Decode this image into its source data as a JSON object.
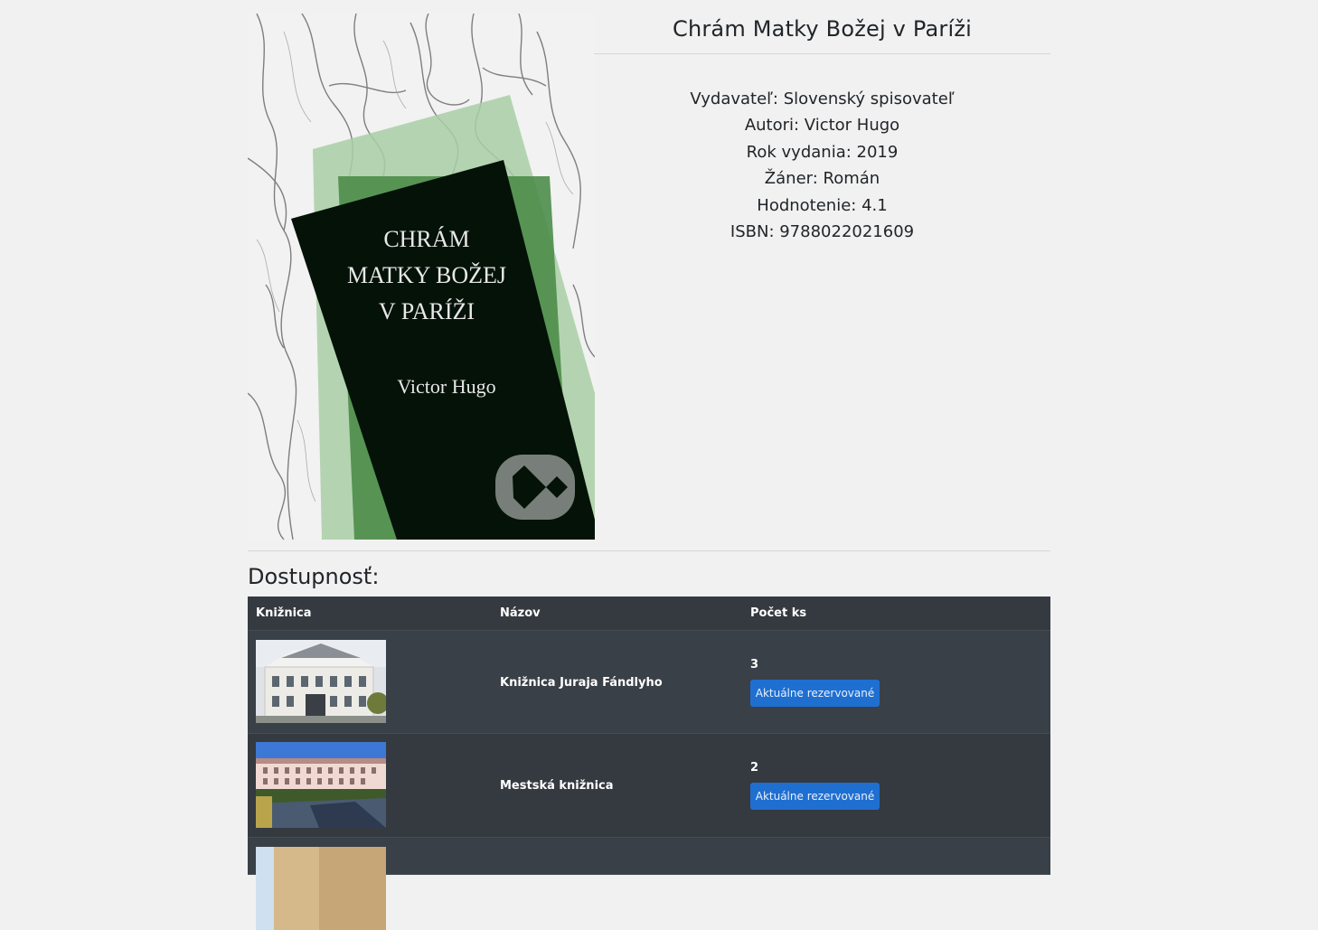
{
  "book": {
    "title": "Chrám Matky Božej v Paríži",
    "cover": {
      "line1": "CHRÁM",
      "line2": "MATKY BOŽEJ",
      "line3": "V PARÍŽI",
      "author": "Victor Hugo"
    },
    "details": [
      "Vydavateľ: Slovenský spisovateľ",
      "Autori: Victor Hugo",
      "Rok vydania: 2019",
      "Žáner: Román",
      "Hodnotenie: 4.1",
      "ISBN: 9788022021609"
    ]
  },
  "availability": {
    "heading": "Dostupnosť:",
    "columns": [
      "Knižnica",
      "Názov",
      "Počet ks"
    ],
    "rows": [
      {
        "name": "Knižnica Juraja Fándlyho",
        "count": "3",
        "button": "Aktuálne rezervované"
      },
      {
        "name": "Mestská knižnica",
        "count": "2",
        "button": "Aktuálne rezervované"
      }
    ]
  },
  "colors": {
    "page_bg": "#f1f1f1",
    "table_bg": "#343a40",
    "button_bg": "#1f6fd1",
    "cover_green": "#3e7f3e",
    "cover_dark": "#041208"
  }
}
